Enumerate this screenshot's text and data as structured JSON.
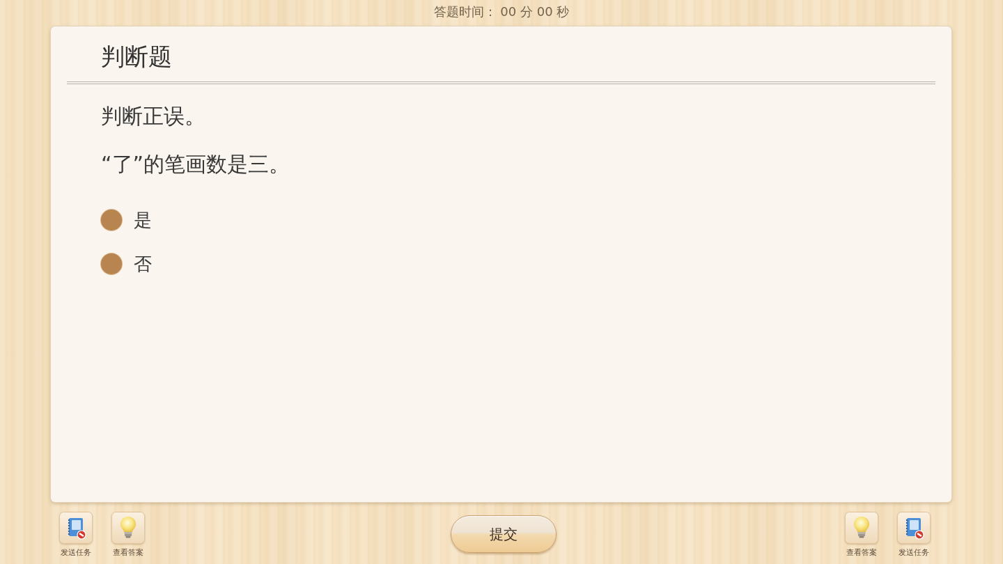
{
  "timer": {
    "text": "答题时间： 00 分 00 秒"
  },
  "question": {
    "type_title": "判断题",
    "instruction": "判断正误。",
    "stem": "“了”的笔画数是三。",
    "options": [
      {
        "label": "是",
        "selected": false
      },
      {
        "label": "否",
        "selected": false
      }
    ]
  },
  "toolbar_left": [
    {
      "kind": "send-task",
      "label": "发送任务"
    },
    {
      "kind": "view-answer",
      "label": "查看答案"
    }
  ],
  "submit_button": {
    "label": "提交"
  },
  "toolbar_right": [
    {
      "kind": "view-answer",
      "label": "查看答案"
    },
    {
      "kind": "send-task",
      "label": "发送任务"
    }
  ]
}
